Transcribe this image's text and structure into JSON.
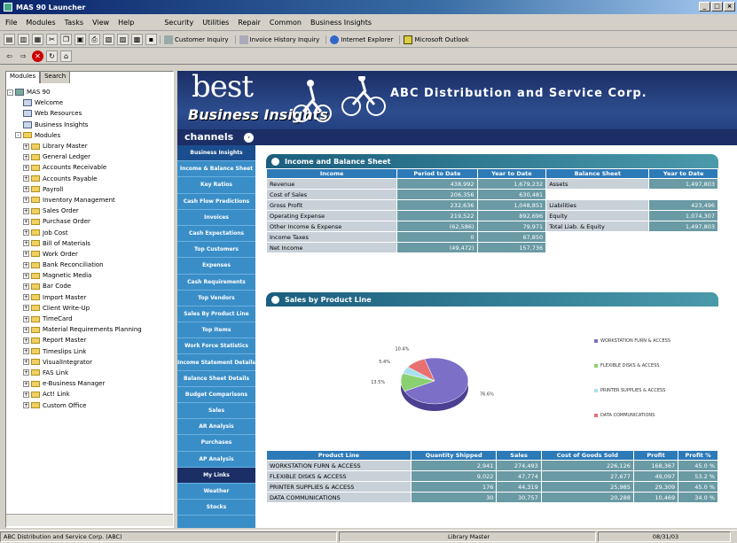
{
  "window": {
    "title": "MAS 90 Launcher"
  },
  "menu": {
    "left": [
      "File",
      "Modules",
      "Tasks",
      "View",
      "Help"
    ],
    "right": [
      "Security",
      "Utilities",
      "Repair",
      "Common",
      "Business Insights"
    ]
  },
  "toolbar": {
    "links": [
      {
        "label": "Customer Inquiry",
        "icon": "customer-icon"
      },
      {
        "label": "Invoice History Inquiry",
        "icon": "invoice-icon"
      },
      {
        "label": "Internet Explorer",
        "icon": "ie-icon"
      },
      {
        "label": "Microsoft Outlook",
        "icon": "outlook-icon"
      }
    ]
  },
  "left_tabs": [
    "Modules",
    "Search"
  ],
  "tree": {
    "root": "MAS 90",
    "top_items": [
      "Welcome",
      "Web Resources",
      "Business Insights"
    ],
    "modules_label": "Modules",
    "modules": [
      "Library Master",
      "General Ledger",
      "Accounts Receivable",
      "Accounts Payable",
      "Payroll",
      "Inventory Management",
      "Sales Order",
      "Purchase Order",
      "Job Cost",
      "Bill of Materials",
      "Work Order",
      "Bank Reconciliation",
      "Magnetic Media",
      "Bar Code",
      "Import Master",
      "Client Write-Up",
      "TimeCard",
      "Material Requirements Planning",
      "Report Master",
      "Timeslips Link",
      "VisualIntegrator",
      "FAS Link",
      "e-Business Manager",
      "Act! Link",
      "Custom Office"
    ]
  },
  "banner": {
    "best": "best",
    "business_insights": "Business Insights",
    "company": "ABC Distribution and Service Corp.",
    "channels": "channels"
  },
  "nav": {
    "header": "Business Insights",
    "items": [
      "Income & Balance Sheet",
      "Key Ratios",
      "Cash Flow Predictions",
      "Invoices",
      "Cash Expectations",
      "Top Customers",
      "Expenses",
      "Cash Requirements",
      "Top Vendors",
      "Sales By Product Line",
      "Top Items",
      "Work Force Statistics",
      "Income Statement Details",
      "Balance Sheet Details",
      "Budget Comparisons",
      "Sales",
      "AR Analysis",
      "Purchases",
      "AP Analysis",
      "My Links",
      "Weather",
      "Stocks"
    ],
    "active": "My Links"
  },
  "income": {
    "title": "Income and Balance Sheet",
    "headers": [
      "Income",
      "Period to Date",
      "Year to Date",
      "Balance Sheet",
      "Year to Date"
    ],
    "rows": [
      [
        "Revenue",
        "438,992",
        "1,679,232",
        "Assets",
        "1,497,803"
      ],
      [
        "Cost of Sales",
        "206,356",
        "630,481",
        "",
        ""
      ],
      [
        "Gross Profit",
        "232,636",
        "1,048,851",
        "Liabilities",
        "423,496"
      ],
      [
        "Operating Expense",
        "219,522",
        "892,696",
        "Equity",
        "1,074,307"
      ],
      [
        "Other Income & Expense",
        "(62,586)",
        "79,971",
        "Total Liab. & Equity",
        "1,497,803"
      ],
      [
        "Income Taxes",
        "0",
        "67,850",
        "",
        ""
      ],
      [
        "Net Income",
        "(49,472)",
        "157,736",
        "",
        ""
      ]
    ]
  },
  "sales": {
    "title": "Sales by Product Line",
    "chart_data": {
      "type": "pie",
      "slices": [
        {
          "label": "WORKSTATION FURN & ACCESS",
          "value": 76.6,
          "color": "#7b6fc8"
        },
        {
          "label": "FLEXIBLE DISKS & ACCESS",
          "value": 13.5,
          "color": "#8ad070"
        },
        {
          "label": "PRINTER SUPPLIES & ACCESS",
          "value": 5.4,
          "color": "#a8e0f0"
        },
        {
          "label": "DATA COMMUNICATIONS",
          "value": 10.4,
          "color": "#e87070"
        }
      ],
      "data_labels": [
        "76.6%",
        "13.5%",
        "5.4%",
        "10.4%"
      ]
    },
    "headers": [
      "Product Line",
      "Quantity Shipped",
      "Sales",
      "Cost of Goods Sold",
      "Profit",
      "Profit %"
    ],
    "rows": [
      [
        "WORKSTATION FURN & ACCESS",
        "2,941",
        "274,493",
        "226,126",
        "168,367",
        "45.0 %"
      ],
      [
        "FLEXIBLE DISKS & ACCESS",
        "9,022",
        "47,774",
        "27,677",
        "49,097",
        "53.2 %"
      ],
      [
        "PRINTER SUPPLIES & ACCESS",
        "176",
        "44,319",
        "25,985",
        "29,309",
        "45.0 %"
      ],
      [
        "DATA COMMUNICATIONS",
        "30",
        "30,757",
        "20,288",
        "10,469",
        "34.0 %"
      ]
    ]
  },
  "status": [
    "ABC Distribution and Service Corp. (ABC)",
    "Library Master",
    "08/31/03"
  ]
}
